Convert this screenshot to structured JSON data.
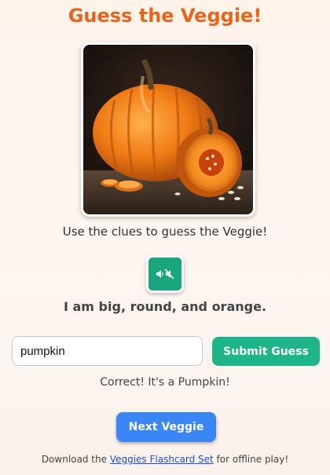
{
  "page": {
    "title": "Guess the Veggie!"
  },
  "image": {
    "alt": "pumpkin"
  },
  "instructions": "Use the clues to guess the Veggie!",
  "sound_button": {
    "icon": "sound-mute-icon"
  },
  "clue": "I am big, round, and orange.",
  "guess_input": {
    "value": "pumpkin"
  },
  "submit_button": {
    "label": "Submit Guess"
  },
  "feedback": "Correct! It's a Pumpkin!",
  "next_button": {
    "label": "Next Veggie"
  },
  "footer": {
    "prefix": "Download the ",
    "link_text": "Veggies Flashcard Set",
    "suffix": " for offline play!"
  },
  "colors": {
    "title": "#e8641b",
    "submit": "#1db589",
    "sound": "#1aa67d",
    "next": "#3a86f5",
    "link": "#1a4fd1"
  }
}
